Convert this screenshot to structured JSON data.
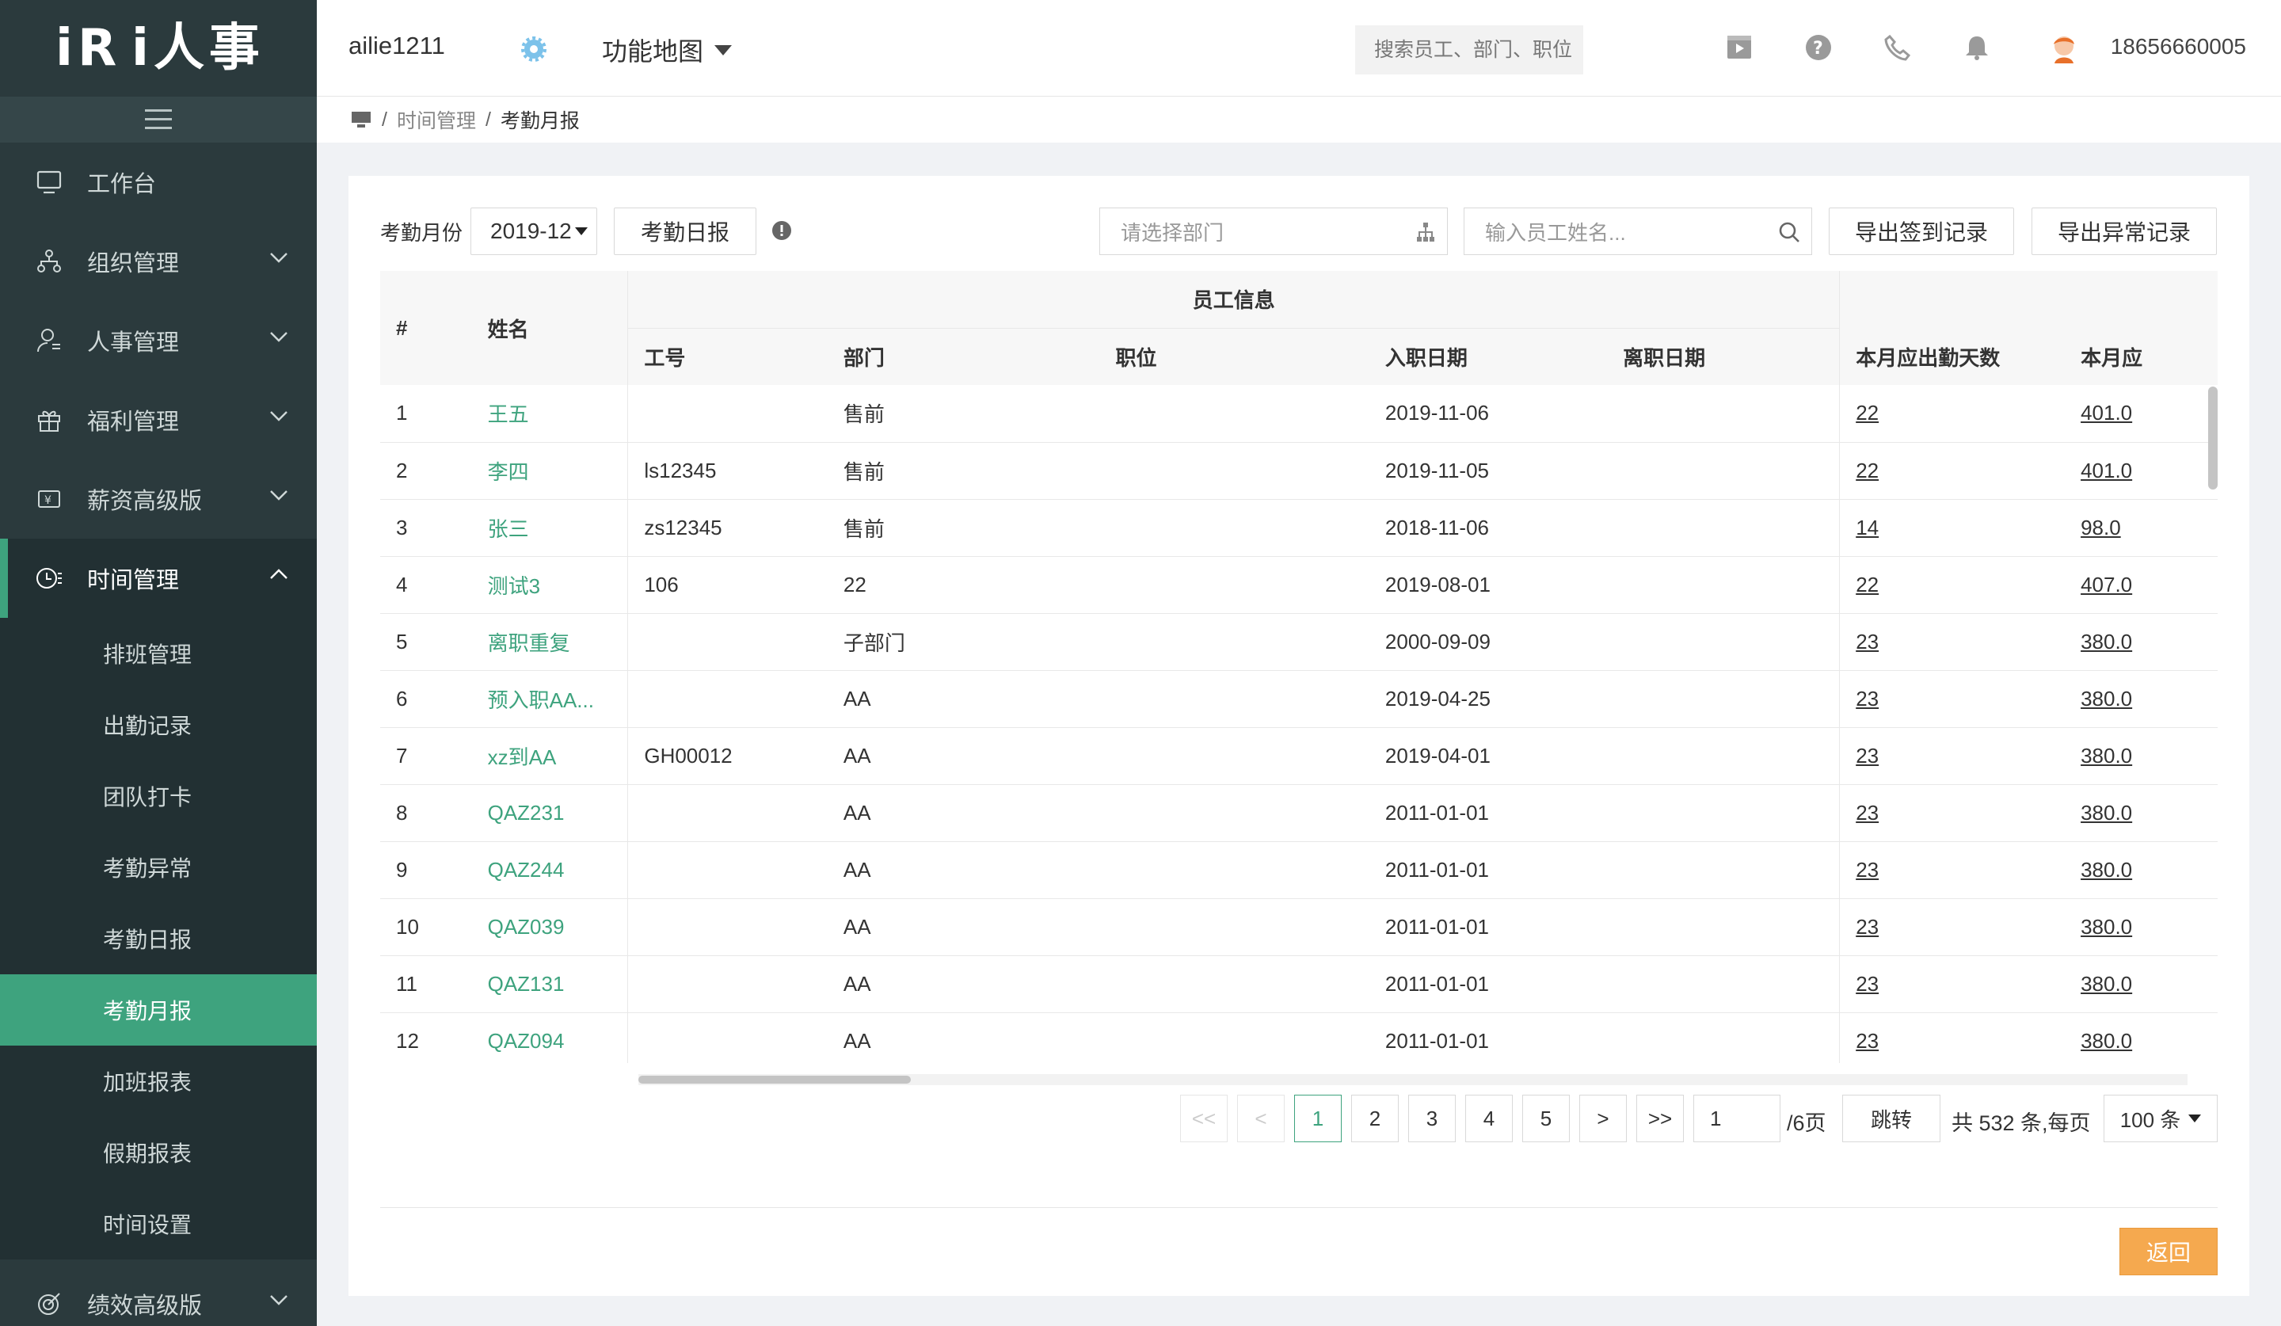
{
  "app": {
    "logo": "iR i人事"
  },
  "sidebar": {
    "items": [
      {
        "label": "工作台",
        "icon": "monitor-icon"
      },
      {
        "label": "组织管理",
        "icon": "org-icon"
      },
      {
        "label": "人事管理",
        "icon": "person-icon"
      },
      {
        "label": "福利管理",
        "icon": "gift-icon"
      },
      {
        "label": "薪资高级版",
        "icon": "salary-icon"
      },
      {
        "label": "时间管理",
        "icon": "clock-icon"
      }
    ],
    "sub_items": [
      "排班管理",
      "出勤记录",
      "团队打卡",
      "考勤异常",
      "考勤日报",
      "考勤月报",
      "加班报表",
      "假期报表",
      "时间设置"
    ],
    "bottom_item": {
      "label": "绩效高级版",
      "icon": "target-icon"
    }
  },
  "header": {
    "username": "ailie1211",
    "function_map": "功能地图",
    "search_placeholder": "搜索员工、部门、职位",
    "phone": "18656660005"
  },
  "breadcrumb": {
    "section": "时间管理",
    "current": "考勤月报",
    "separator": "/"
  },
  "toolbar": {
    "month_label": "考勤月份",
    "month_value": "2019-12",
    "daily_report": "考勤日报",
    "dept_placeholder": "请选择部门",
    "name_placeholder": "输入员工姓名...",
    "export_sign": "导出签到记录",
    "export_abnormal": "导出异常记录"
  },
  "table": {
    "group_header": "员工信息",
    "headers": {
      "index": "#",
      "name": "姓名",
      "emp_no": "工号",
      "dept": "部门",
      "position": "职位",
      "join_date": "入职日期",
      "leave_date": "离职日期",
      "due_days": "本月应出勤天数",
      "due_hours": "本月应"
    },
    "rows": [
      {
        "idx": "1",
        "name": "王五",
        "emp_no": "",
        "dept": "售前",
        "position": "",
        "join": "2019-11-06",
        "leave": "",
        "days": "22",
        "hours": "401.0"
      },
      {
        "idx": "2",
        "name": "李四",
        "emp_no": "ls12345",
        "dept": "售前",
        "position": "",
        "join": "2019-11-05",
        "leave": "",
        "days": "22",
        "hours": "401.0"
      },
      {
        "idx": "3",
        "name": "张三",
        "emp_no": "zs12345",
        "dept": "售前",
        "position": "",
        "join": "2018-11-06",
        "leave": "",
        "days": "14",
        "hours": "98.0"
      },
      {
        "idx": "4",
        "name": "测试3",
        "emp_no": "106",
        "dept": "22",
        "position": "",
        "join": "2019-08-01",
        "leave": "",
        "days": "22",
        "hours": "407.0"
      },
      {
        "idx": "5",
        "name": "离职重复",
        "emp_no": "",
        "dept": "子部门",
        "position": "",
        "join": "2000-09-09",
        "leave": "",
        "days": "23",
        "hours": "380.0"
      },
      {
        "idx": "6",
        "name": "预入职AA...",
        "emp_no": "",
        "dept": "AA",
        "position": "",
        "join": "2019-04-25",
        "leave": "",
        "days": "23",
        "hours": "380.0"
      },
      {
        "idx": "7",
        "name": "xz到AA",
        "emp_no": "GH00012",
        "dept": "AA",
        "position": "",
        "join": "2019-04-01",
        "leave": "",
        "days": "23",
        "hours": "380.0"
      },
      {
        "idx": "8",
        "name": "QAZ231",
        "emp_no": "",
        "dept": "AA",
        "position": "",
        "join": "2011-01-01",
        "leave": "",
        "days": "23",
        "hours": "380.0"
      },
      {
        "idx": "9",
        "name": "QAZ244",
        "emp_no": "",
        "dept": "AA",
        "position": "",
        "join": "2011-01-01",
        "leave": "",
        "days": "23",
        "hours": "380.0"
      },
      {
        "idx": "10",
        "name": "QAZ039",
        "emp_no": "",
        "dept": "AA",
        "position": "",
        "join": "2011-01-01",
        "leave": "",
        "days": "23",
        "hours": "380.0"
      },
      {
        "idx": "11",
        "name": "QAZ131",
        "emp_no": "",
        "dept": "AA",
        "position": "",
        "join": "2011-01-01",
        "leave": "",
        "days": "23",
        "hours": "380.0"
      },
      {
        "idx": "12",
        "name": "QAZ094",
        "emp_no": "",
        "dept": "AA",
        "position": "",
        "join": "2011-01-01",
        "leave": "",
        "days": "23",
        "hours": "380.0"
      }
    ]
  },
  "pagination": {
    "first": "<<",
    "prev": "<",
    "pages": [
      "1",
      "2",
      "3",
      "4",
      "5"
    ],
    "next": ">",
    "last": ">>",
    "jump_value": "1",
    "total_pages_text": "/6页",
    "jump_button": "跳转",
    "total_text": "共 532 条,每页",
    "page_size": "100 条",
    "current_page": "1"
  },
  "footer": {
    "back": "返回"
  },
  "colors": {
    "accent": "#3ea37e",
    "sidebar_bg": "#2b3a3d",
    "back_button": "#f5a94f"
  }
}
